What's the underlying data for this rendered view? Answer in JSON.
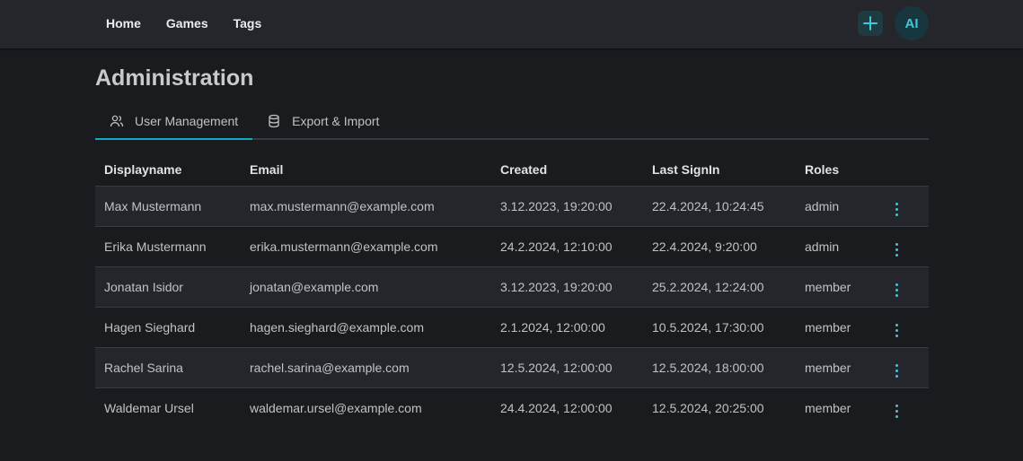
{
  "nav": {
    "items": [
      {
        "label": "Home"
      },
      {
        "label": "Games"
      },
      {
        "label": "Tags"
      }
    ]
  },
  "header": {
    "add_icon": "plus-icon",
    "avatar_initials": "AI",
    "accent_color": "#3bc9db"
  },
  "page": {
    "title": "Administration"
  },
  "tabs": [
    {
      "label": "User Management",
      "icon": "users-icon",
      "active": true
    },
    {
      "label": "Export & Import",
      "icon": "database-icon",
      "active": false
    }
  ],
  "table": {
    "columns": [
      "Displayname",
      "Email",
      "Created",
      "Last SignIn",
      "Roles"
    ],
    "rows": [
      {
        "name": "Max Mustermann",
        "email": "max.mustermann@example.com",
        "created": "3.12.2023, 19:20:00",
        "last_signin": "22.4.2024, 10:24:45",
        "role": "admin"
      },
      {
        "name": "Erika Mustermann",
        "email": "erika.mustermann@example.com",
        "created": "24.2.2024, 12:10:00",
        "last_signin": "22.4.2024, 9:20:00",
        "role": "admin"
      },
      {
        "name": "Jonatan Isidor",
        "email": "jonatan@example.com",
        "created": "3.12.2023, 19:20:00",
        "last_signin": "25.2.2024, 12:24:00",
        "role": "member"
      },
      {
        "name": "Hagen Sieghard",
        "email": "hagen.sieghard@example.com",
        "created": "2.1.2024, 12:00:00",
        "last_signin": "10.5.2024, 17:30:00",
        "role": "member"
      },
      {
        "name": "Rachel Sarina",
        "email": "rachel.sarina@example.com",
        "created": "12.5.2024, 12:00:00",
        "last_signin": "12.5.2024, 18:00:00",
        "role": "member"
      },
      {
        "name": "Waldemar Ursel",
        "email": "waldemar.ursel@example.com",
        "created": "24.4.2024, 12:00:00",
        "last_signin": "12.5.2024, 20:25:00",
        "role": "member"
      }
    ]
  }
}
